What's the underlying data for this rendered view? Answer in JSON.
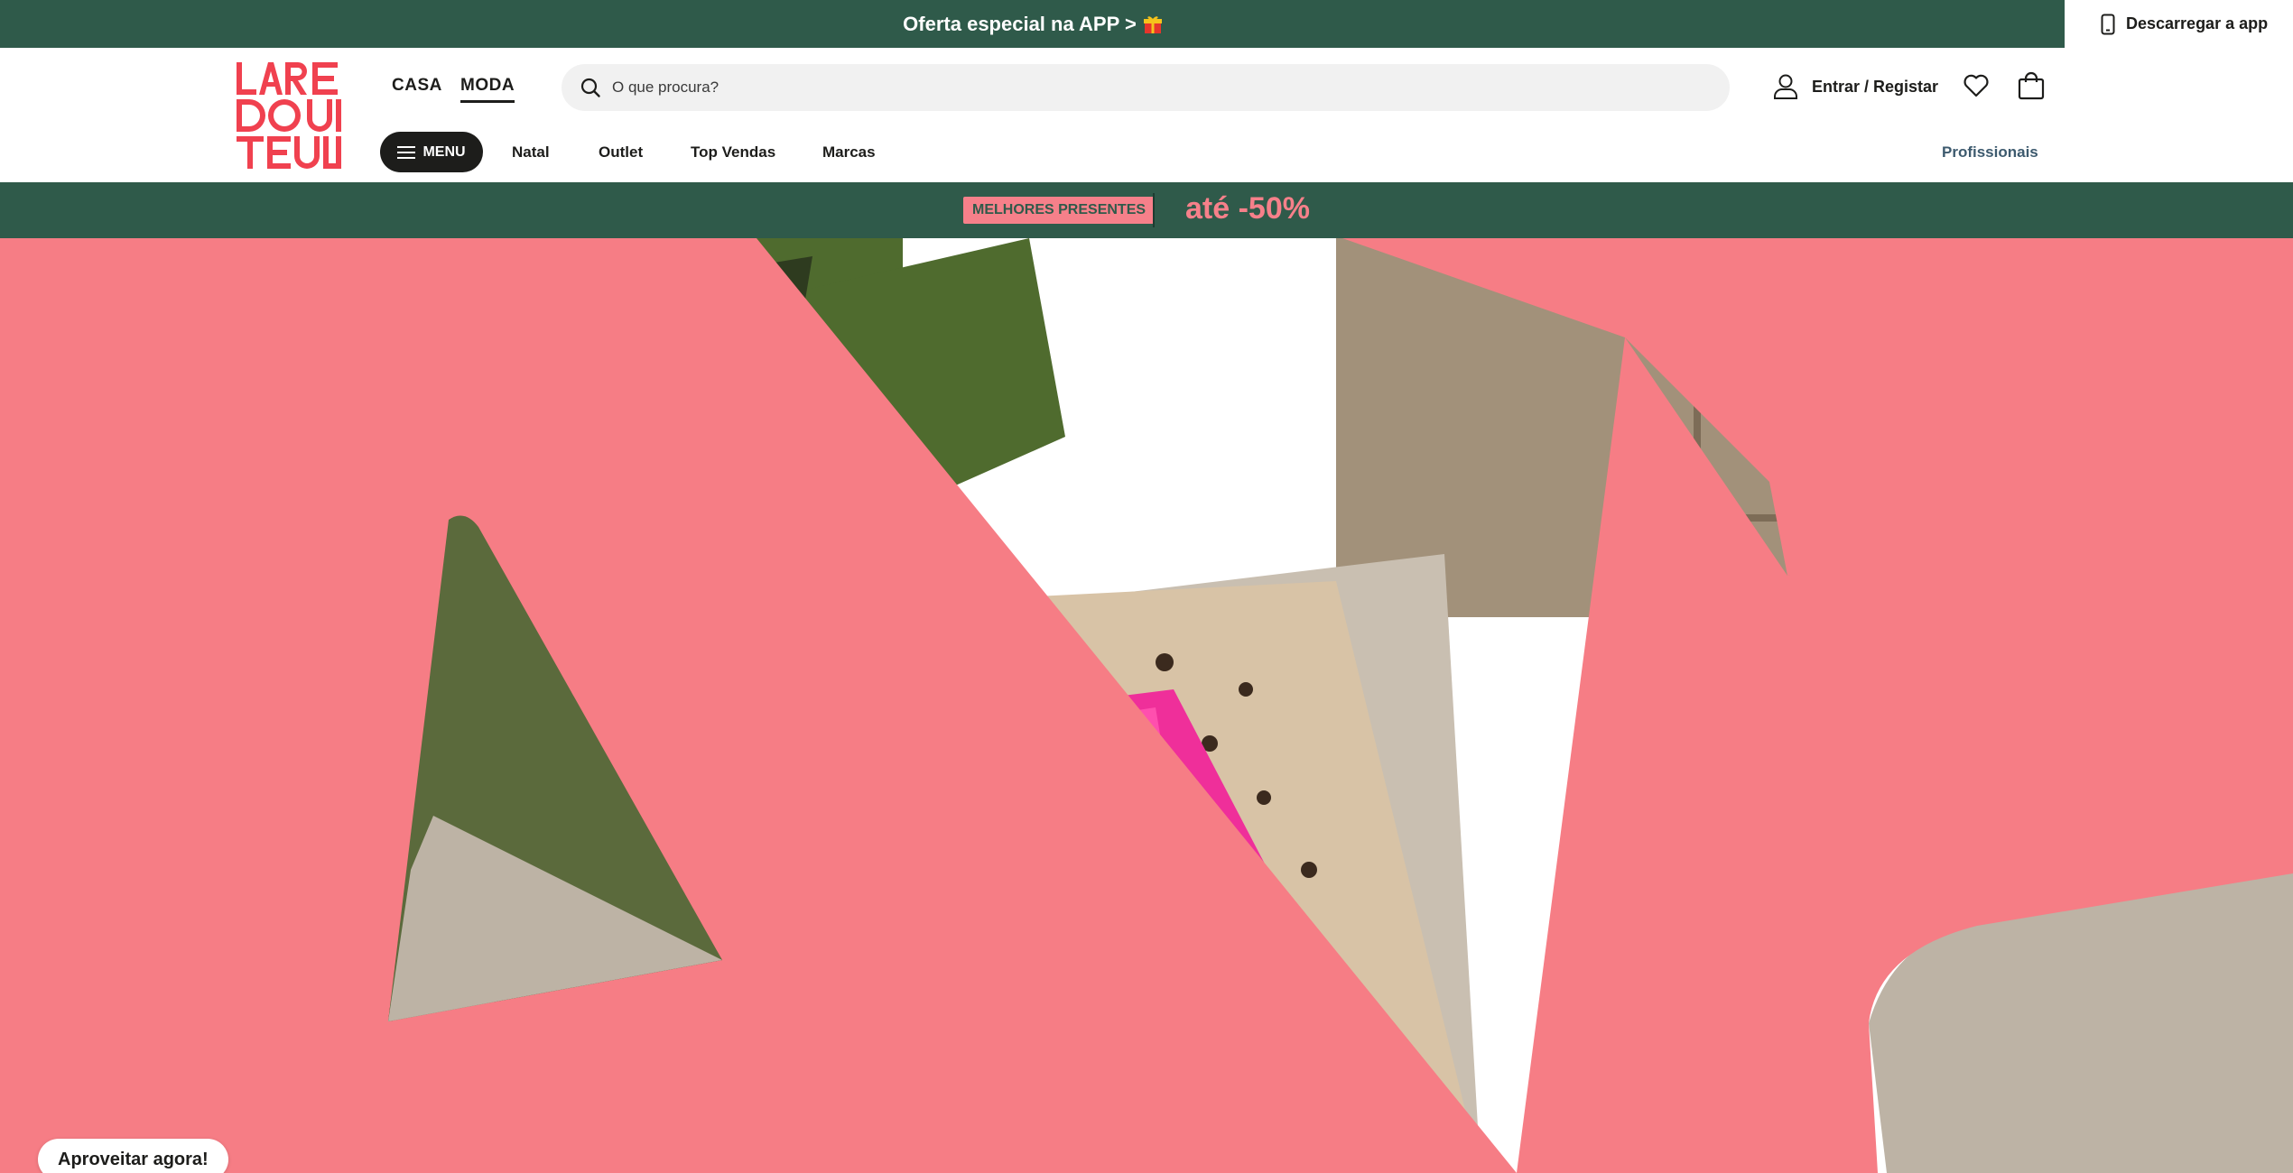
{
  "topbar": {
    "promo_text": "Oferta especial na APP >",
    "promo_icon": "gift-icon",
    "app_button_label": "Descarregar a app",
    "app_button_icon": "smartphone-icon",
    "background": "#2f5a4a"
  },
  "header": {
    "logo": "La Redoute",
    "universes": [
      {
        "label": "CASA",
        "active": false
      },
      {
        "label": "MODA",
        "active": true
      }
    ],
    "search": {
      "placeholder": "O que procura?",
      "value": "",
      "icon": "search-icon"
    },
    "account": {
      "label": "Entrar / Registar",
      "icon": "user-icon"
    },
    "wishlist_icon": "heart-icon",
    "bag_icon": "shopping-bag-icon",
    "menu_label": "MENU",
    "menu_icon": "hamburger-icon",
    "categories": [
      "Natal",
      "Outlet",
      "Top Vendas",
      "Marcas"
    ],
    "pro_link": "Profissionais"
  },
  "subbanner": {
    "badge": "MELHORES PRESENTES",
    "discount": "até -50%",
    "accent": "#f6808a"
  },
  "hero": {
    "cta_label": "Aproveitar agora!",
    "accent": "#f67d85"
  }
}
